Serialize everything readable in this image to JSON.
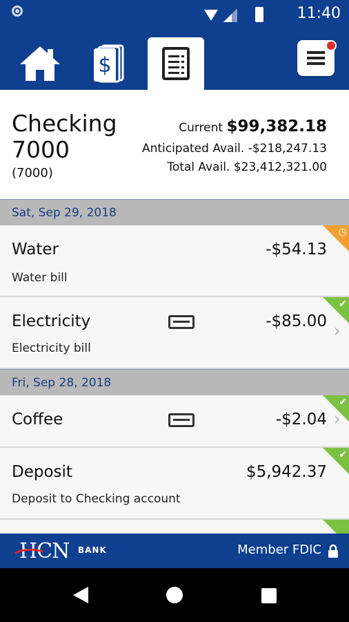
{
  "status_bar": {
    "time": "11:40"
  },
  "tabs": [
    {
      "name": "home",
      "icon": "home-icon"
    },
    {
      "name": "transfers",
      "icon": "dollar-cards-icon"
    },
    {
      "name": "transactions",
      "icon": "document-icon",
      "active": true
    }
  ],
  "account": {
    "name": "Checking 7000",
    "number": "(7000)",
    "current_label": "Current",
    "current_value": "$99,382.18",
    "anticipated_label": "Anticipated Avail.",
    "anticipated_value": "-$218,247.13",
    "total_label": "Total Avail.",
    "total_value": "$23,412,321.00"
  },
  "groups": [
    {
      "date": "Sat, Sep 29, 2018",
      "transactions": [
        {
          "name": "Water",
          "description": "Water bill",
          "amount": "-$54.13",
          "status": "pending"
        },
        {
          "name": "Electricity",
          "description": "Electricity bill",
          "amount": "-$85.00",
          "status": "cleared",
          "has_image": true
        }
      ]
    },
    {
      "date": "Fri, Sep 28, 2018",
      "transactions": [
        {
          "name": "Coffee",
          "amount": "-$2.04",
          "status": "cleared",
          "has_image": true
        },
        {
          "name": "Deposit",
          "description": "Deposit to Checking account",
          "amount": "$5,942.37",
          "status": "cleared"
        }
      ]
    }
  ],
  "footer": {
    "logo_text": "HCN",
    "logo_sub": "BANK",
    "fdic": "Member FDIC"
  },
  "colors": {
    "brand": "#0f3f8f",
    "pending": "#f0a030",
    "cleared": "#7cc242",
    "alert": "#e52d2d"
  }
}
